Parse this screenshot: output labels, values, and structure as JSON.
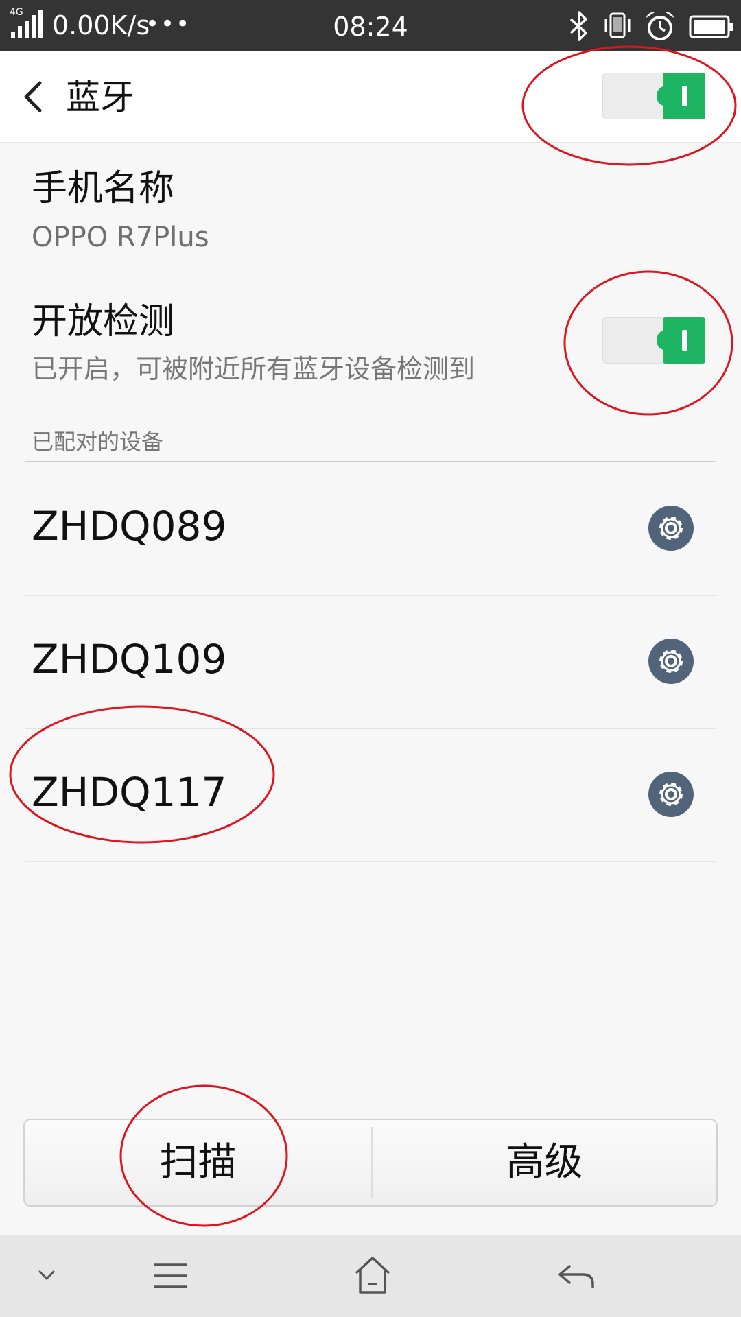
{
  "status_bar": {
    "network_type": "4G",
    "net_speed": "0.00K/s",
    "more_dots": "•••",
    "time": "08:24"
  },
  "header": {
    "title": "蓝牙",
    "bluetooth_switch_on": true
  },
  "device_name_row": {
    "title": "手机名称",
    "value": "OPPO R7Plus"
  },
  "visibility_row": {
    "title": "开放检测",
    "subtitle": "已开启，可被附近所有蓝牙设备检测到",
    "switch_on": true
  },
  "paired_section": {
    "label": "已配对的设备",
    "devices": [
      {
        "name": "ZHDQ089"
      },
      {
        "name": "ZHDQ109"
      },
      {
        "name": "ZHDQ117"
      }
    ]
  },
  "bottom_buttons": {
    "scan": "扫描",
    "advanced": "高级"
  },
  "colors": {
    "status_bar_bg": "#343434",
    "switch_on": "#1db462",
    "gear_icon": "#52647a",
    "annotation": "#e0141e"
  },
  "icons": {
    "status": [
      "signal-icon",
      "bluetooth-icon",
      "vibrate-icon",
      "alarm-icon",
      "battery-icon"
    ],
    "nav": [
      "chevron-down-icon",
      "menu-icon",
      "home-icon",
      "back-arrow-icon"
    ]
  }
}
